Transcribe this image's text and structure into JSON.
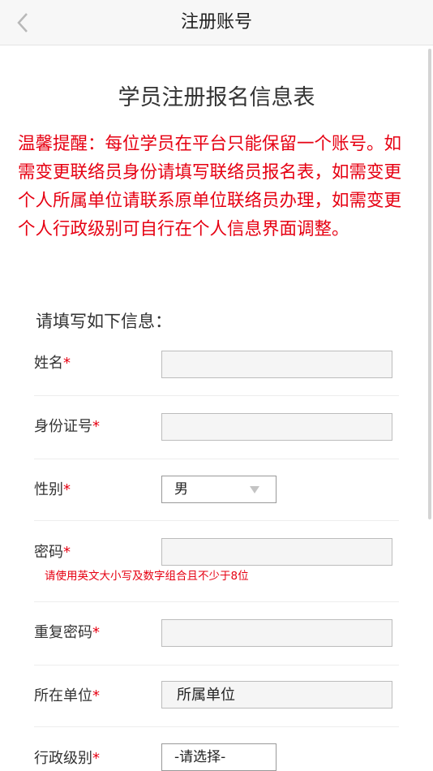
{
  "navbar": {
    "title": "注册账号",
    "back_icon": "chevron-left-icon"
  },
  "form": {
    "title": "学员注册报名信息表",
    "notice": "温馨提醒：每位学员在平台只能保留一个账号。如需变更联络员身份请填写联络员报名表，如需变更个人所属单位请联系原单位联络员办理，如需变更个人行政级别可自行在个人信息界面调整。",
    "intro": "请填写如下信息：",
    "required_mark": "*",
    "fields": {
      "name": {
        "label": "姓名",
        "value": ""
      },
      "id_number": {
        "label": "身份证号",
        "value": ""
      },
      "gender": {
        "label": "性别",
        "selected": "男"
      },
      "password": {
        "label": "密码",
        "value": "",
        "hint": "请使用英文大小写及数字组合且不少于8位"
      },
      "repeat_password": {
        "label": "重复密码",
        "value": ""
      },
      "unit": {
        "label": "所在单位",
        "value": "所属单位"
      },
      "admin_level": {
        "label": "行政级别",
        "selected": "-请选择-"
      }
    }
  },
  "colors": {
    "accent_red": "#e60012",
    "input_bg": "#f5f5f5"
  }
}
